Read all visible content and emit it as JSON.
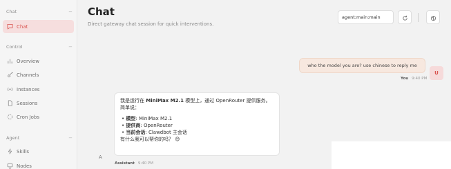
{
  "sidebar": {
    "chat_section": {
      "heading": "Chat",
      "collapse": "−"
    },
    "chat_item": {
      "label": "Chat"
    },
    "control_section": {
      "heading": "Control",
      "collapse": "−"
    },
    "control_items": [
      {
        "label": "Overview",
        "icon": "bar-chart-icon"
      },
      {
        "label": "Channels",
        "icon": "link-icon"
      },
      {
        "label": "Instances",
        "icon": "radio-icon"
      },
      {
        "label": "Sessions",
        "icon": "file-icon"
      },
      {
        "label": "Cron Jobs",
        "icon": "loader-icon"
      }
    ],
    "agent_section": {
      "heading": "Agent",
      "collapse": "−"
    },
    "agent_items": [
      {
        "label": "Skills",
        "icon": "zap-icon"
      },
      {
        "label": "Nodes",
        "icon": "monitor-icon"
      }
    ]
  },
  "header": {
    "title": "Chat",
    "subtitle": "Direct gateway chat session for quick interventions.",
    "session_value": "agent:main:main"
  },
  "messages": {
    "user": {
      "text": "who the model you are? use chinese to reply me",
      "avatar": "U",
      "sender": "You",
      "time": "9:40 PM"
    },
    "assistant": {
      "line1_prefix": "我是运行在 ",
      "line1_model": "MiniMax M2.1",
      "line1_suffix": " 模型上，通过 OpenRouter 提供服务。",
      "summary": "简单说：",
      "items": [
        {
          "key": "模型",
          "value": ": MiniMax M2.1"
        },
        {
          "key": "提供商",
          "value": ": OpenRouter"
        },
        {
          "key": "当前会话",
          "value": ": Clawdbot 主会话"
        }
      ],
      "closing": "有什么我可以帮你的吗？ 😊",
      "avatar": "A",
      "sender": "Assistant",
      "time": "9:40 PM"
    }
  },
  "colors": {
    "accent": "#d9534f",
    "active_bg": "#f6dede",
    "user_bubble": "#f7e8df"
  }
}
